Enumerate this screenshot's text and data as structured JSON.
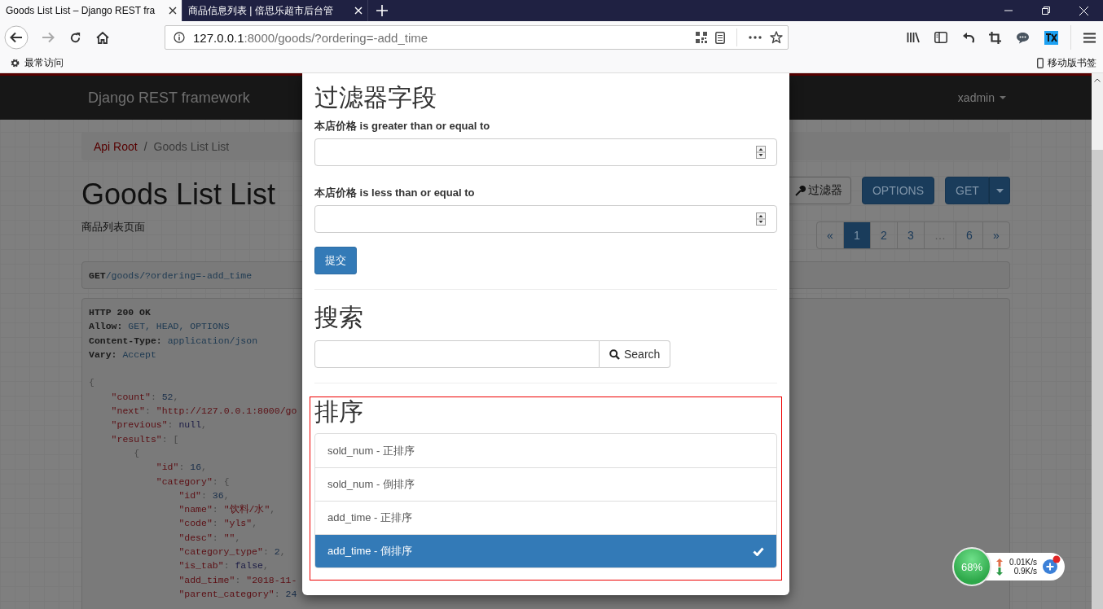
{
  "browser": {
    "tabs": [
      {
        "title": "Goods List List – Django REST fra",
        "selected": true
      },
      {
        "title": "商品信息列表 | 倍思乐超市后台管",
        "selected": false
      }
    ],
    "address": {
      "host": "127.0.0.1",
      "rest": ":8000/goods/?ordering=-add_time"
    },
    "bookmark": "最常访问",
    "mobile_bookmarks": "移动版书签"
  },
  "page": {
    "brand": "Django REST framework",
    "user": "xadmin",
    "breadcrumb": [
      {
        "label": "Api Root",
        "kind": "link"
      },
      {
        "label": "Goods List List",
        "kind": "current"
      }
    ],
    "separator": "/",
    "title": "Goods List List",
    "description": "商品列表页面",
    "filter_button": "过滤器",
    "options_button": "OPTIONS",
    "get_button": "GET",
    "pagination": [
      {
        "label": "«",
        "selected": false
      },
      {
        "label": "1",
        "selected": true
      },
      {
        "label": "2",
        "selected": false
      },
      {
        "label": "3",
        "selected": false
      },
      {
        "label": "…",
        "selected": false
      },
      {
        "label": "6",
        "selected": false
      },
      {
        "label": "»",
        "selected": false
      }
    ],
    "request": {
      "method": "GET",
      "path": "/goods/?ordering=-add_time"
    },
    "response": {
      "status": "HTTP 200 OK",
      "headers": [
        {
          "name": "Allow:",
          "value": "GET, HEAD, OPTIONS"
        },
        {
          "name": "Content-Type:",
          "value": "application/json"
        },
        {
          "name": "Vary:",
          "value": "Accept"
        }
      ],
      "body": [
        {
          "parts": [
            {
              "kind": "punct",
              "text": "{"
            }
          ],
          "children": [
            {
              "parts": [
                {
                  "kind": "key",
                  "text": "\"count\""
                },
                {
                  "kind": "punct",
                  "text": ": "
                },
                {
                  "kind": "number",
                  "text": "52"
                },
                {
                  "kind": "punct",
                  "text": ","
                }
              ]
            },
            {
              "parts": [
                {
                  "kind": "key",
                  "text": "\"next\""
                },
                {
                  "kind": "punct",
                  "text": ": "
                },
                {
                  "kind": "string",
                  "text": "\"http://127.0.0.1:8000/go"
                }
              ]
            },
            {
              "parts": [
                {
                  "kind": "key",
                  "text": "\"previous\""
                },
                {
                  "kind": "punct",
                  "text": ": "
                },
                {
                  "kind": "literal",
                  "text": "null"
                },
                {
                  "kind": "punct",
                  "text": ","
                }
              ]
            },
            {
              "parts": [
                {
                  "kind": "key",
                  "text": "\"results\""
                },
                {
                  "kind": "punct",
                  "text": ": ["
                }
              ],
              "children": [
                {
                  "parts": [
                    {
                      "kind": "punct",
                      "text": "{"
                    }
                  ],
                  "children": [
                    {
                      "parts": [
                        {
                          "kind": "key",
                          "text": "\"id\""
                        },
                        {
                          "kind": "punct",
                          "text": ": "
                        },
                        {
                          "kind": "number",
                          "text": "16"
                        },
                        {
                          "kind": "punct",
                          "text": ","
                        }
                      ]
                    },
                    {
                      "parts": [
                        {
                          "kind": "key",
                          "text": "\"category\""
                        },
                        {
                          "kind": "punct",
                          "text": ": {"
                        }
                      ],
                      "children": [
                        {
                          "parts": [
                            {
                              "kind": "key",
                              "text": "\"id\""
                            },
                            {
                              "kind": "punct",
                              "text": ": "
                            },
                            {
                              "kind": "number",
                              "text": "36"
                            },
                            {
                              "kind": "punct",
                              "text": ","
                            }
                          ]
                        },
                        {
                          "parts": [
                            {
                              "kind": "key",
                              "text": "\"name\""
                            },
                            {
                              "kind": "punct",
                              "text": ": "
                            },
                            {
                              "kind": "string",
                              "text": "\"饮料/水\""
                            },
                            {
                              "kind": "punct",
                              "text": ","
                            }
                          ]
                        },
                        {
                          "parts": [
                            {
                              "kind": "key",
                              "text": "\"code\""
                            },
                            {
                              "kind": "punct",
                              "text": ": "
                            },
                            {
                              "kind": "string",
                              "text": "\"yls\""
                            },
                            {
                              "kind": "punct",
                              "text": ","
                            }
                          ]
                        },
                        {
                          "parts": [
                            {
                              "kind": "key",
                              "text": "\"desc\""
                            },
                            {
                              "kind": "punct",
                              "text": ": "
                            },
                            {
                              "kind": "string",
                              "text": "\"\""
                            },
                            {
                              "kind": "punct",
                              "text": ","
                            }
                          ]
                        },
                        {
                          "parts": [
                            {
                              "kind": "key",
                              "text": "\"category_type\""
                            },
                            {
                              "kind": "punct",
                              "text": ": "
                            },
                            {
                              "kind": "number",
                              "text": "2"
                            },
                            {
                              "kind": "punct",
                              "text": ","
                            }
                          ]
                        },
                        {
                          "parts": [
                            {
                              "kind": "key",
                              "text": "\"is_tab\""
                            },
                            {
                              "kind": "punct",
                              "text": ": "
                            },
                            {
                              "kind": "literal",
                              "text": "false"
                            },
                            {
                              "kind": "punct",
                              "text": ","
                            }
                          ]
                        },
                        {
                          "parts": [
                            {
                              "kind": "key",
                              "text": "\"add_time\""
                            },
                            {
                              "kind": "punct",
                              "text": ": "
                            },
                            {
                              "kind": "string",
                              "text": "\"2018-11-"
                            }
                          ]
                        },
                        {
                          "parts": [
                            {
                              "kind": "key",
                              "text": "\"parent_category\""
                            },
                            {
                              "kind": "punct",
                              "text": ": "
                            },
                            {
                              "kind": "number",
                              "text": "24"
                            }
                          ]
                        }
                      ]
                    }
                  ]
                }
              ]
            }
          ]
        }
      ]
    }
  },
  "modal": {
    "filter_title": "过滤器字段",
    "fields": [
      {
        "label": "本店价格 is greater than or equal to"
      },
      {
        "label": "本店价格 is less than or equal to"
      }
    ],
    "submit": "提交",
    "search_title": "搜索",
    "search_button": "Search",
    "ordering_title": "排序",
    "ordering": [
      {
        "label": "sold_num - 正排序",
        "selected": false
      },
      {
        "label": "sold_num - 倒排序",
        "selected": false
      },
      {
        "label": "add_time - 正排序",
        "selected": false
      },
      {
        "label": "add_time - 倒排序",
        "selected": true
      }
    ]
  },
  "net_widget": {
    "percent": "68%",
    "up": "0.01K/s",
    "down": "0.9K/s"
  }
}
